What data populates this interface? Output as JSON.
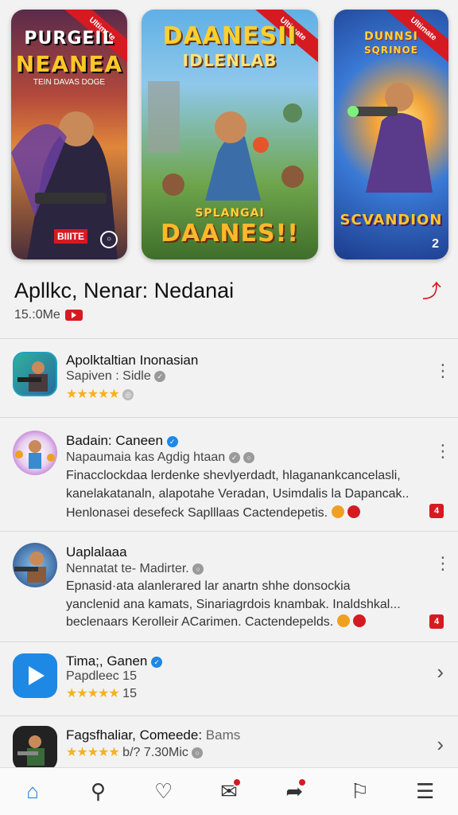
{
  "banners": [
    {
      "ribbon": "Ultimate",
      "title": "PURGEIL",
      "title2": "NEANEA",
      "subtitle": "TEIN DAVAS DOGE",
      "footer": "BIIITE",
      "footer_right": "○"
    },
    {
      "ribbon": "Ultimate",
      "title": "DAANESII",
      "title2": "IDLENLAB",
      "subtitle": "SPLANGAI",
      "footer": "DAANES!!"
    },
    {
      "ribbon": "Ultimate",
      "title": "DUNNSI",
      "title2": "SQRINOE",
      "footer": "SCVANDION",
      "footer_right": "2"
    }
  ],
  "app": {
    "title": "Apllkc, Nenar: Nedanai",
    "size": "15.:0Me"
  },
  "items": [
    {
      "name": "Apolktaltian Inonasian",
      "line1": "Sapiven : Sidle",
      "stars": "★★★★★"
    },
    {
      "name": "Badain: Caneen",
      "line1": "Napaumaia kas Agdig htaan",
      "desc1": "Finacclockdaa lerdenke shevlyerdadt, hlaganankcancelasli,",
      "desc2": "kanelakatanaln, alapotahe Veradan, Usimdalis la Dapancak..",
      "desc3": "Henlonasei desefeck Saplllaas Cactendepetis."
    },
    {
      "name": "Uaplalaaa",
      "line1": "Nennatat te- Madirter.",
      "desc1": "Epnasid·ata alanlerared lar anartn shhe donsockia",
      "desc2": "yanclenid ana kamats, Sinariagrdois knambak. Inaldshkal...",
      "desc3": "beclenaars Kerolleir ACarimen. Cactendepelds."
    },
    {
      "name": "Tima;, Ganen",
      "line1": "Papdleec 15",
      "stars": "★★★★★",
      "rating": "15"
    },
    {
      "name": "Fagsfhaliar, Comeede:",
      "name_extra": "Bams",
      "stars": "★★★★★",
      "size": "b/? 7.30Mic"
    }
  ],
  "icons": {
    "share": "⤴",
    "kebab": "⋮",
    "chevron": "›",
    "home": "⌂",
    "search": "⚲",
    "heart": "♡",
    "mail": "✉",
    "share_tab": "➦",
    "bookmark": "⚐",
    "menu": "☰"
  },
  "colors": {
    "accent": "#1e7be0",
    "brand_red": "#d61a22",
    "star": "#f5b21b"
  }
}
